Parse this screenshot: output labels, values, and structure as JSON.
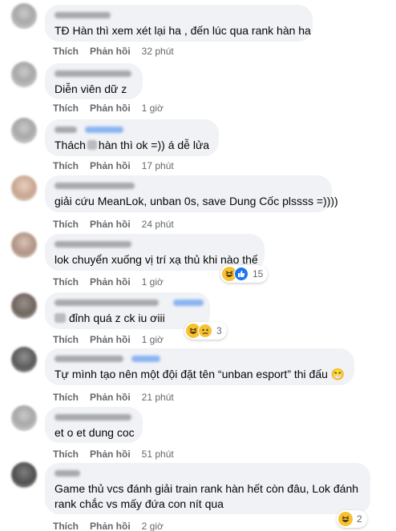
{
  "labels": {
    "like": "Thích",
    "reply": "Phản hồi"
  },
  "comments": [
    {
      "text": "TĐ Hàn thì xem xét lại ha , đến lúc qua rank hàn ha",
      "time": "32 phút"
    },
    {
      "text": "Diễn viên dữ z",
      "time": "1 giờ"
    },
    {
      "text_before": "Thách",
      "text_after": "hàn thì ok =)) á dễ lửa",
      "time": "17 phút"
    },
    {
      "text": "giải cứu MeanLok, unban 0s, save Dung Cốc plssss =))))",
      "time": "24 phút"
    },
    {
      "text": "lok chuyển xuống vị trí xạ thủ khi nào thế",
      "time": "1 giờ",
      "reactions": [
        "haha",
        "like"
      ],
      "reaction_count": "15"
    },
    {
      "text": "đỉnh quá z ck iu ơiii",
      "time": "1 giờ",
      "reactions": [
        "haha",
        "sad"
      ],
      "reaction_count": "3"
    },
    {
      "text": "Tự mình tạo nên một đội đặt tên “unban esport” thi đấu 😁",
      "time": "21 phút"
    },
    {
      "text": "et o et dung coc",
      "time": "51 phút"
    },
    {
      "line1": "Game thủ vcs đánh giải train rank hàn hết còn đâu, Lok đánh",
      "line2": "rank chắc vs mấy đứa con nít qua",
      "time": "2 giờ",
      "reactions": [
        "haha"
      ],
      "reaction_count": "2"
    }
  ],
  "colors": {
    "bubble": "#f0f2f5",
    "meta": "#65676b",
    "text": "#050505",
    "link_blue": "#1877f2"
  }
}
